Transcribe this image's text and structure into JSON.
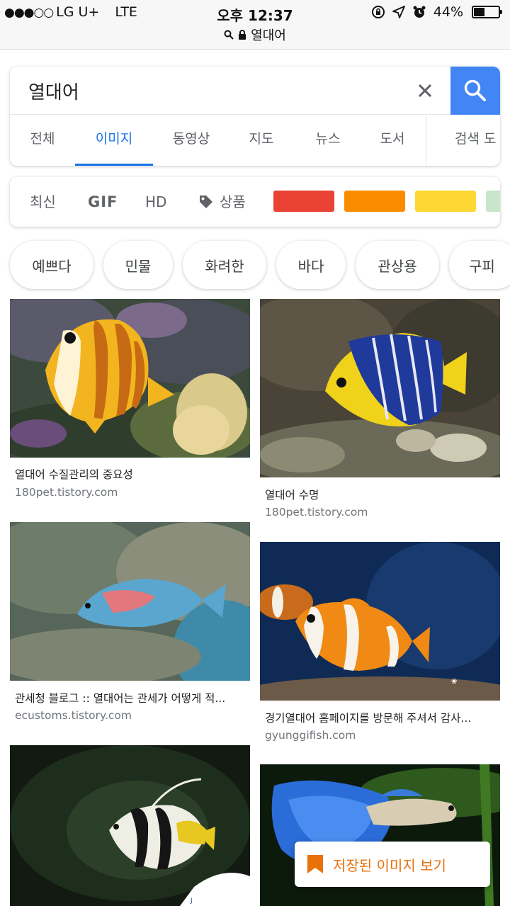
{
  "status_bar": {
    "signal": "●●●○○",
    "carrier": "LG U+",
    "network": "LTE",
    "time": "오후 12:37",
    "url_text": "열대어",
    "battery": "44%",
    "battery_level": 0.44
  },
  "search": {
    "query": "열대어",
    "tabs": [
      "전체",
      "이미지",
      "동영상",
      "지도",
      "뉴스",
      "도서",
      "검색 도"
    ],
    "active_tab": "이미지"
  },
  "filters": {
    "recent": "최신",
    "gif": "GIF",
    "hd": "HD",
    "product": "상품",
    "colors": [
      "#ea4335",
      "#fb8c00",
      "#fdd835",
      "#c8e6c9"
    ]
  },
  "chips": [
    "예쁘다",
    "민물",
    "화려한",
    "바다",
    "관상용",
    "구피"
  ],
  "results": [
    {
      "title": "열대어 수질관리의 중요성",
      "source": "180pet.tistory.com"
    },
    {
      "title": "열대어 수명",
      "source": "180pet.tistory.com"
    },
    {
      "title": "관세청 블로그 :: 열대어는 관세가 어떻게 적...",
      "source": "ecustoms.tistory.com"
    },
    {
      "title": "경기열대어 홈페이지를 방문해 주셔서 감사...",
      "source": "gyunggifish.com"
    },
    {
      "title": "",
      "source": ""
    },
    {
      "title": "",
      "source": ""
    }
  ],
  "saved_images_button": "저장된 이미지 보기",
  "colors": {
    "accent": "#1a73e8",
    "search_button": "#4285f4",
    "saved_button_text": "#e8710a"
  },
  "icons": {
    "search": "search-icon",
    "clear": "close-icon",
    "lock": "lock-icon",
    "tag": "tag-icon",
    "bookmark": "bookmark-icon",
    "alarm": "alarm-icon",
    "location": "location-arrow-icon",
    "rotation_lock": "rotation-lock-icon"
  }
}
